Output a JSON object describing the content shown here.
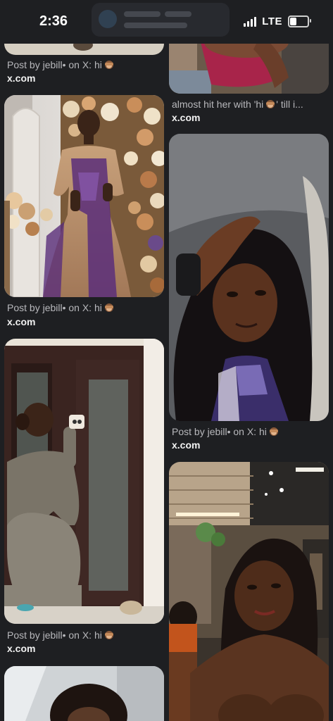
{
  "status": {
    "time": "2:36",
    "network": "LTE",
    "battery_level": 0.35
  },
  "feed": {
    "left": [
      {
        "caption": "Post by jebill• on X: hi",
        "source": "x.com",
        "emoji": "see-no-evil-monkey-icon"
      },
      {
        "caption": "Post by jebill• on X: hi",
        "source": "x.com",
        "emoji": "see-no-evil-monkey-icon"
      },
      {
        "caption": "Post by jebill• on X: hi",
        "source": "x.com",
        "emoji": "see-no-evil-monkey-icon"
      }
    ],
    "right": [
      {
        "caption": "almost hit her with 'hi",
        "caption_tail": "' till i...",
        "source": "x.com",
        "emoji": "see-no-evil-monkey-icon"
      },
      {
        "caption": "Post by jebill• on X: hi",
        "source": "x.com",
        "emoji": "see-no-evil-monkey-icon"
      }
    ]
  },
  "colors": {
    "background": "#1e1f22",
    "caption": "#b8b8bc",
    "source": "#f2f2f2"
  }
}
